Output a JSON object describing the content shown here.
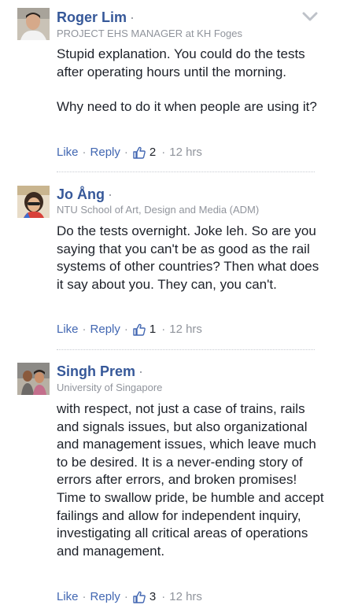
{
  "comments": [
    {
      "name": "Roger Lim",
      "dot": "·",
      "subtitle": "PROJECT EHS MANAGER at KH Foges",
      "paragraphs": [
        "Stupid explanation. You could do the tests after operating hours until the morning.",
        "Why need to do it when people are using it?"
      ],
      "like_label": "Like",
      "reply_label": "Reply",
      "like_count": "2",
      "time": "12 hrs"
    },
    {
      "name": "Jo Ång",
      "dot": "·",
      "subtitle": "NTU School of Art, Design and Media (ADM)",
      "paragraphs": [
        "Do the tests overnight. Joke leh. So are you saying that you can't be as good as the rail systems of other countries? Then what does it say about you. They can, you can't."
      ],
      "like_label": "Like",
      "reply_label": "Reply",
      "like_count": "1",
      "time": "12 hrs"
    },
    {
      "name": "Singh Prem",
      "dot": "·",
      "subtitle": "University of Singapore",
      "paragraphs": [
        "with respect, not just a case of trains, rails and signals issues, but also organizational and management issues, which leave much to be desired. It is a never-ending story of errors after errors, and broken promises! Time to swallow pride, be humble and accept failings and allow for independent inquiry, investigating all critical areas of operations and management."
      ],
      "like_label": "Like",
      "reply_label": "Reply",
      "like_count": "3",
      "time": "12 hrs"
    }
  ],
  "icons": {
    "menu": "chevron-down-icon",
    "like": "thumbs-up-icon"
  },
  "colors": {
    "name": "#365899",
    "link": "#4267b2",
    "meta": "#90949c",
    "text": "#1d2129"
  }
}
